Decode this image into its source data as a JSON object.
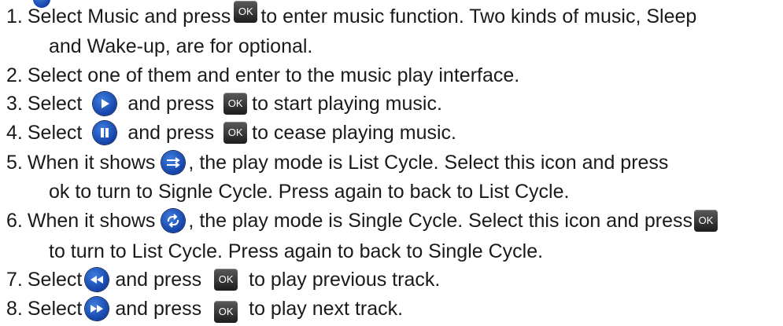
{
  "lines": [
    {
      "n": "1.",
      "a": "Select Music and press",
      "b": "to enter music function. Two kinds of music, Sleep"
    },
    {
      "c": "and Wake-up, are for optional."
    },
    {
      "n": "2.",
      "a": "Select one of them and enter to the music play interface."
    },
    {
      "n": "3.",
      "a": "Select",
      "b": "and press",
      "c": "to start playing music."
    },
    {
      "n": "4.",
      "a": "Select",
      "b": "and press",
      "c": "to cease playing music."
    },
    {
      "n": "5.",
      "a": "When it shows",
      "b": ", the play mode is List Cycle. Select this icon and press"
    },
    {
      "c": "ok to turn to Signle Cycle. Press again to back to List Cycle."
    },
    {
      "n": "6.",
      "a": "When it shows",
      "b": ", the play mode is Single Cycle. Select this icon and press"
    },
    {
      "c": "to turn to List Cycle. Press again to back to Single Cycle."
    },
    {
      "n": "7.",
      "a": "Select",
      "b": "and press",
      "c": "to play previous track."
    },
    {
      "n": "8.",
      "a": "Select",
      "b": "and press",
      "c": "to play next track."
    }
  ],
  "ok_label": "OK",
  "icons": [
    "play-icon",
    "pause-icon",
    "list-cycle-icon",
    "single-cycle-icon",
    "previous-track-icon",
    "next-track-icon",
    "ok-key-icon"
  ],
  "colors": {
    "icon_blue": "#1442a8",
    "ok_key": "#2a2a2a",
    "text": "#1a1a1a"
  }
}
